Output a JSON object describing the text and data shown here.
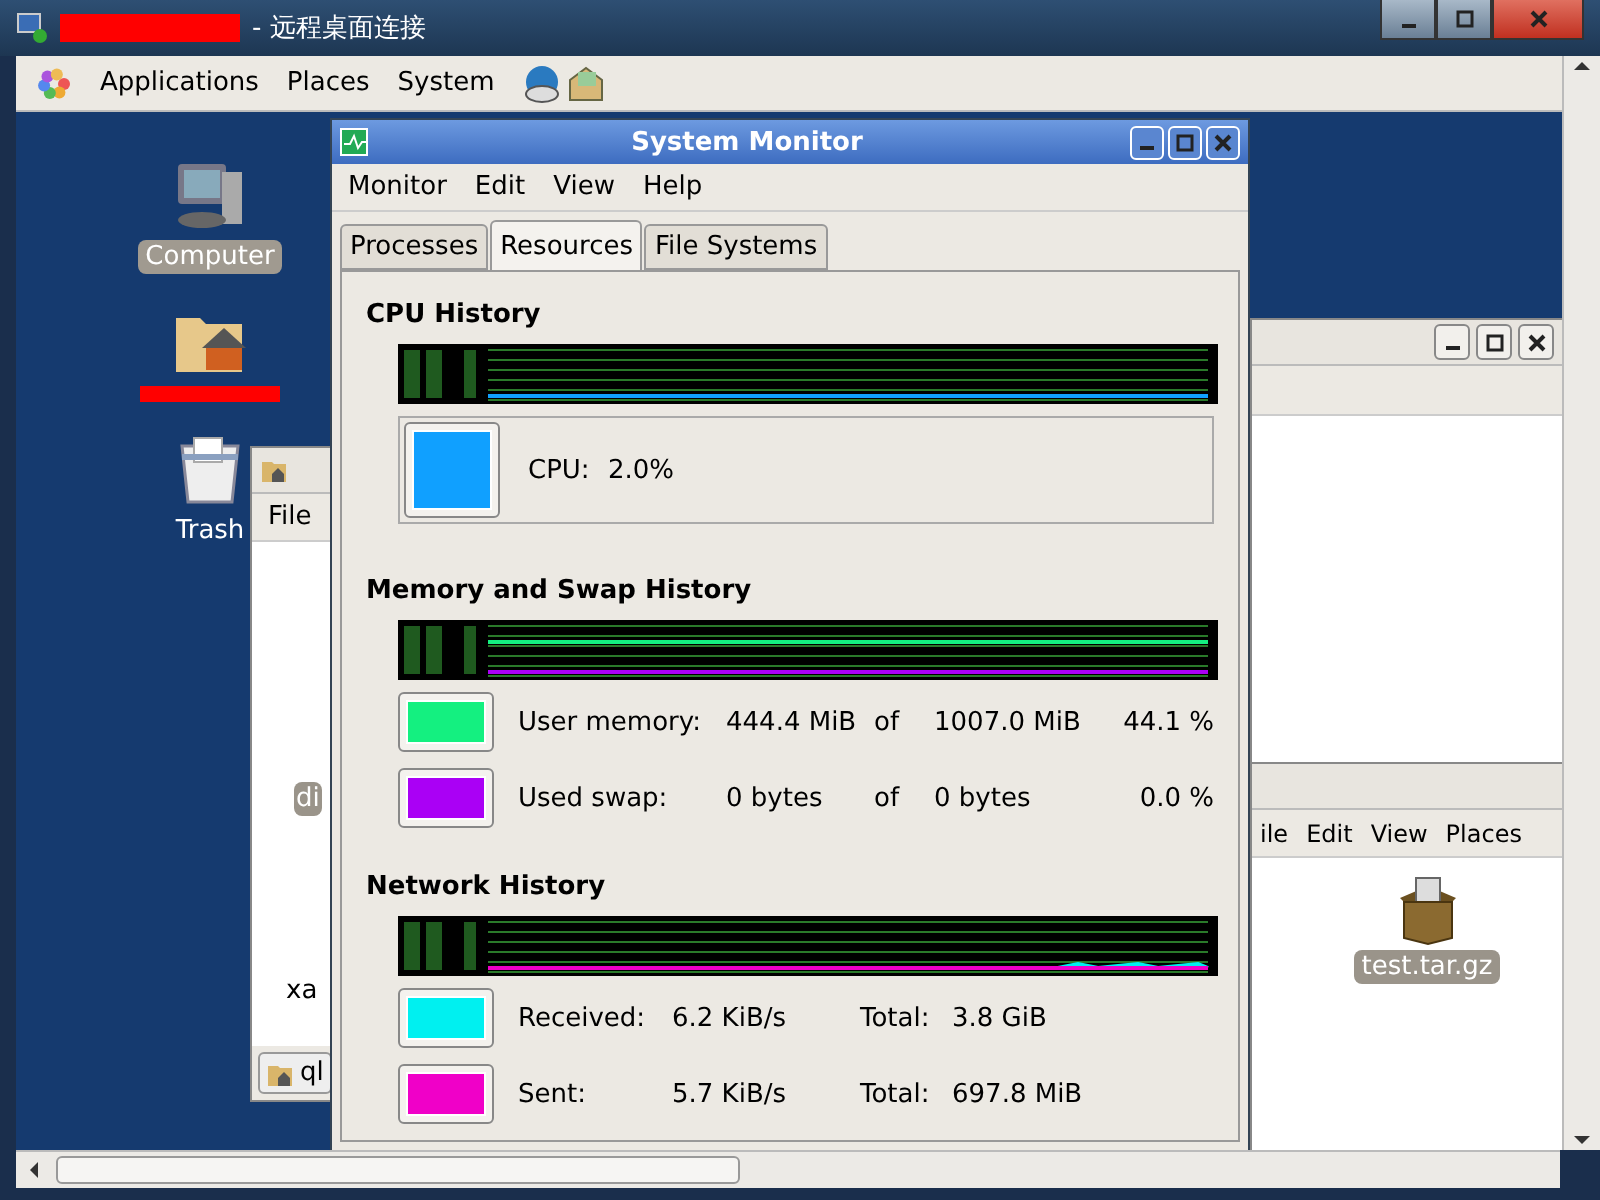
{
  "remote_window": {
    "title": "- 远程桌面连接"
  },
  "panel": {
    "menus": [
      "Applications",
      "Places",
      "System"
    ]
  },
  "desktop_icons": [
    {
      "kind": "computer",
      "label": "Computer",
      "selected": true
    },
    {
      "kind": "home",
      "redacted": true
    },
    {
      "kind": "trash",
      "label": "Trash",
      "selected": false
    }
  ],
  "left_window": {
    "menus": [
      "File"
    ],
    "item_1": "di",
    "item_2": "xa",
    "task_button": "ql"
  },
  "right_window": {
    "menus": [
      "ile",
      "Edit",
      "View",
      "Places"
    ],
    "file": "test.tar.gz"
  },
  "system_monitor": {
    "title": "System Monitor",
    "menus": [
      "Monitor",
      "Edit",
      "View",
      "Help"
    ],
    "tabs": [
      {
        "label": "Processes",
        "selected": false
      },
      {
        "label": "Resources",
        "selected": true
      },
      {
        "label": "File Systems",
        "selected": false
      }
    ],
    "cpu": {
      "heading": "CPU History",
      "items": [
        {
          "label": "CPU:",
          "value": "2.0%",
          "color": "#10a0ff"
        }
      ]
    },
    "memory": {
      "heading": "Memory and Swap History",
      "items": [
        {
          "label": "User memory:",
          "used": "444.4 MiB",
          "of": "of",
          "total": "1007.0 MiB",
          "percent": "44.1 %",
          "color": "#14f080"
        },
        {
          "label": "Used swap:",
          "used": "0 bytes",
          "of": "of",
          "total": "0 bytes",
          "percent": "0.0 %",
          "color": "#aa00f5"
        }
      ]
    },
    "network": {
      "heading": "Network History",
      "items": [
        {
          "label": "Received:",
          "rate": "6.2 KiB/s",
          "total_label": "Total:",
          "total": "3.8 GiB",
          "color": "#00f0f0"
        },
        {
          "label": "Sent:",
          "rate": "5.7 KiB/s",
          "total_label": "Total:",
          "total": "697.8 MiB",
          "color": "#f000c8"
        }
      ]
    }
  }
}
